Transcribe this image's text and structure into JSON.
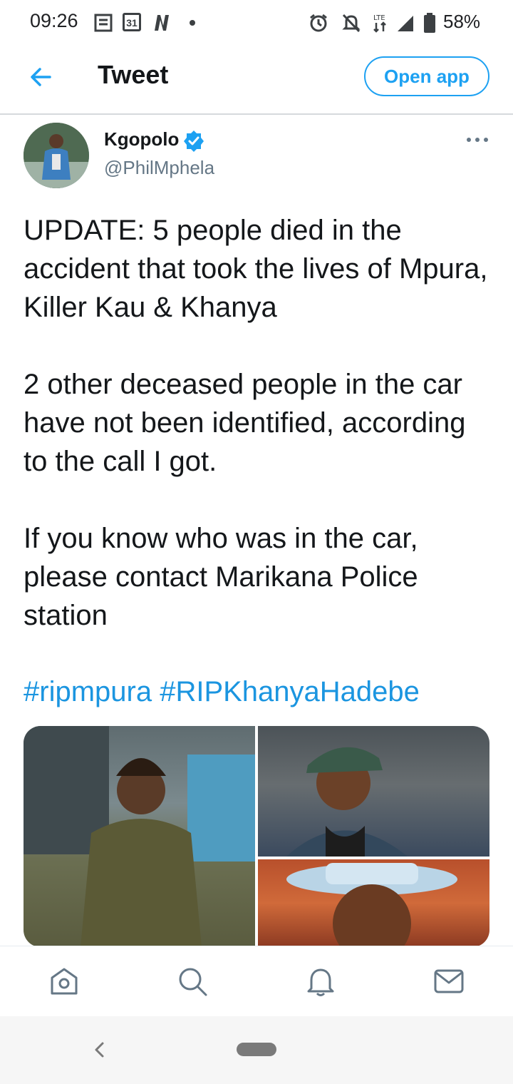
{
  "status_bar": {
    "time": "09:26",
    "calendar_day": "31",
    "battery_percent": "58%",
    "network": "LTE"
  },
  "header": {
    "title": "Tweet",
    "open_app_label": "Open app"
  },
  "author": {
    "name": "Kgopolo",
    "handle": "@PhilMphela",
    "verified": true
  },
  "tweet": {
    "paragraphs": [
      "UPDATE: 5 people died in the accident that took the lives of Mpura, Killer Kau & Khanya",
      "2 other deceased people in the car have not been identified, according to the call I got.",
      "If you know who was in the car, please contact Marikana Police station"
    ],
    "hashtags": [
      "#ripmpura",
      "#RIPKhanyaHadebe"
    ]
  },
  "colors": {
    "accent": "#1da1f2",
    "link": "#1b95e0",
    "text": "#14171a",
    "secondary": "#657786"
  },
  "bottom_nav": [
    "home-icon",
    "search-icon",
    "notifications-icon",
    "messages-icon"
  ]
}
